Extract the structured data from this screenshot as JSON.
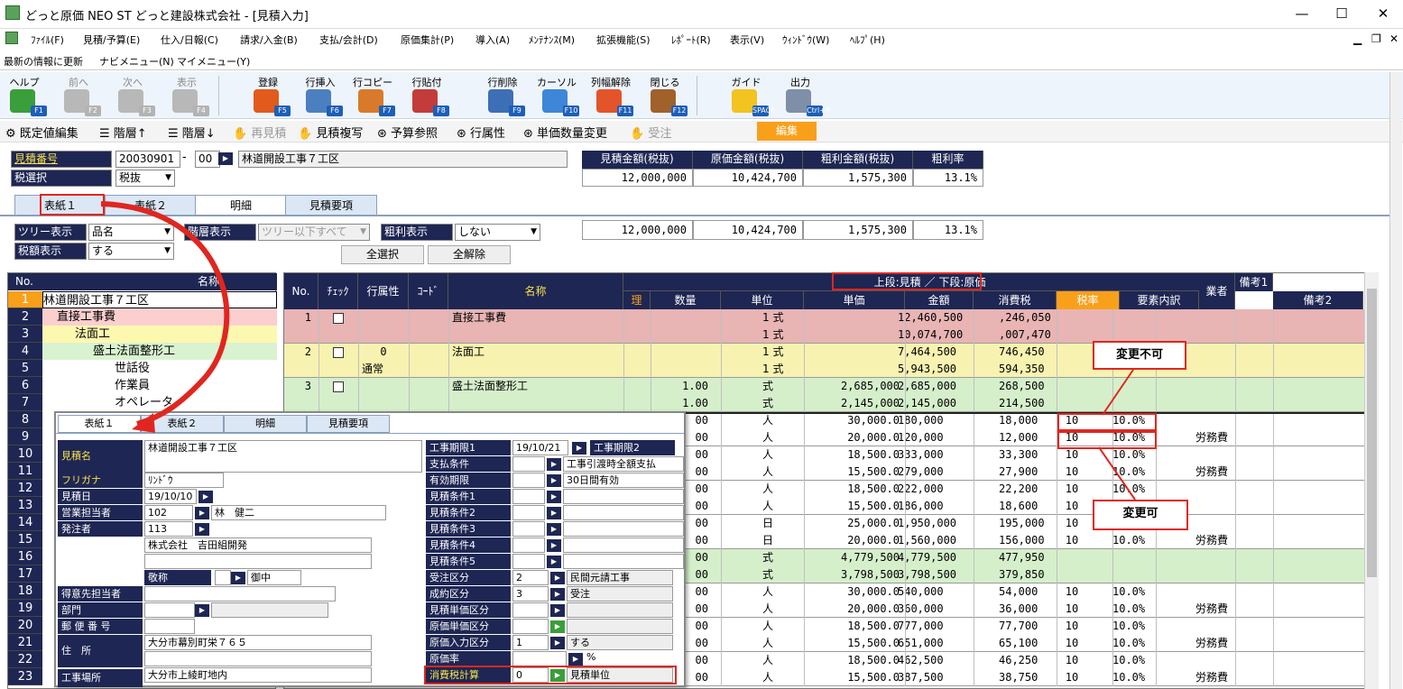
{
  "window": {
    "title": "どっと原価 NEO ST どっと建設株式会社 - [見積入力]",
    "min": "—",
    "max": "☐",
    "close": "✕"
  },
  "menu": [
    "ﾌｧｲﾙ(F)",
    "見積/予算(E)",
    "仕入/日報(C)",
    "請求/入金(B)",
    "支払/会計(D)",
    "原価集計(P)",
    "導入(A)",
    "ﾒﾝﾃﾅﾝｽ(M)",
    "拡張機能(S)",
    "ﾚﾎﾟｰﾄ(R)",
    "表示(V)",
    "ｳｨﾝﾄﾞｳ(W)",
    "ﾍﾙﾌﾟ(H)"
  ],
  "nav": [
    "最新の情報に更新",
    "ナビメニュー(N)",
    "マイメニュー(Y)"
  ],
  "toolbar": [
    {
      "label": "ヘルプ",
      "key": "F1",
      "icon": "help-icon",
      "color": "#3a9e3a",
      "disabled": false
    },
    {
      "label": "前へ",
      "key": "F2",
      "icon": "back-arrow-icon",
      "color": "#b8b8b8",
      "disabled": true
    },
    {
      "label": "次へ",
      "key": "F3",
      "icon": "forward-arrow-icon",
      "color": "#b8b8b8",
      "disabled": true
    },
    {
      "label": "表示",
      "key": "F4",
      "icon": "magnifier-icon",
      "color": "#b8b8b8",
      "disabled": true
    },
    {
      "label": "登録",
      "key": "F5",
      "icon": "ok-icon",
      "color": "#e25a1c",
      "disabled": false
    },
    {
      "label": "行挿入",
      "key": "F6",
      "icon": "row-insert-icon",
      "color": "#4c7fc0",
      "disabled": false
    },
    {
      "label": "行コピー",
      "key": "F7",
      "icon": "row-copy-icon",
      "color": "#d97a2b",
      "disabled": false
    },
    {
      "label": "行貼付",
      "key": "F8",
      "icon": "row-paste-icon",
      "color": "#c43b3b",
      "disabled": false
    },
    {
      "label": "行削除",
      "key": "F9",
      "icon": "row-delete-icon",
      "color": "#3d6fb6",
      "disabled": false
    },
    {
      "label": "カーソル",
      "key": "F10",
      "icon": "cursor-move-icon",
      "color": "#3d86d8",
      "disabled": false
    },
    {
      "label": "列幅解除",
      "key": "F11",
      "icon": "column-width-icon",
      "color": "#e3542b",
      "disabled": false
    },
    {
      "label": "閉じる",
      "key": "F12",
      "icon": "door-close-icon",
      "color": "#a0612b",
      "disabled": false
    },
    {
      "label": "ガイド",
      "key": "SPACE",
      "icon": "lightbulb-icon",
      "color": "#f2c321",
      "disabled": false
    },
    {
      "label": "出力",
      "key": "Ctrl+P",
      "icon": "printer-icon",
      "color": "#7f8fa8",
      "disabled": false
    }
  ],
  "subbar": [
    "既定値編集",
    "階層↑",
    "階層↓",
    "再見積",
    "見積複写",
    "予算参照",
    "行属性",
    "単価数量変更",
    "受注"
  ],
  "edit_label": "編集",
  "header": {
    "estimate_no_label": "見積番号",
    "estimate_no": "20030901",
    "dash": "-",
    "branch": "00",
    "project_name": "林道開設工事７工区",
    "tax_label": "税選択",
    "tax_value": "税抜"
  },
  "summary": {
    "headers": [
      "見積金額(税抜)",
      "原価金額(税抜)",
      "粗利金額(税抜)",
      "粗利率"
    ],
    "values": [
      "12,000,000",
      "10,424,700",
      "1,575,300",
      "13.1%"
    ],
    "values2": [
      "12,000,000",
      "10,424,700",
      "1,575,300",
      "13.1%"
    ]
  },
  "tabs": [
    "表紙１",
    "表紙２",
    "明細",
    "見積要項"
  ],
  "filters": {
    "tree_label": "ツリー表示",
    "tree_value": "品名",
    "tax_disp_label": "税額表示",
    "tax_disp_value": "する",
    "level_label": "階層表示",
    "level_value": "ツリー以下すべて",
    "gross_label": "粗利表示",
    "gross_value": "しない",
    "select_all": "全選択",
    "deselect_all": "全解除"
  },
  "tree": {
    "header_no": "No.",
    "header_name": "名称",
    "rows": [
      {
        "no": "1",
        "name": "林道開設工事７工区"
      },
      {
        "no": "2",
        "name": "直接工事費"
      },
      {
        "no": "3",
        "name": "法面工"
      },
      {
        "no": "4",
        "name": "盛土法面整形工"
      },
      {
        "no": "5",
        "name": "世話役"
      },
      {
        "no": "6",
        "name": "作業員"
      },
      {
        "no": "7",
        "name": "オペレータ"
      },
      {
        "no": "8",
        "name": ""
      },
      {
        "no": "9",
        "name": ""
      },
      {
        "no": "10",
        "name": ""
      },
      {
        "no": "11",
        "name": ""
      },
      {
        "no": "12",
        "name": ""
      },
      {
        "no": "13",
        "name": ""
      },
      {
        "no": "14",
        "name": ""
      },
      {
        "no": "15",
        "name": ""
      },
      {
        "no": "16",
        "name": ""
      },
      {
        "no": "17",
        "name": ""
      },
      {
        "no": "18",
        "name": ""
      },
      {
        "no": "19",
        "name": ""
      },
      {
        "no": "20",
        "name": ""
      },
      {
        "no": "21",
        "name": ""
      },
      {
        "no": "22",
        "name": ""
      },
      {
        "no": "23",
        "name": ""
      }
    ]
  },
  "grid": {
    "top_header": "上段:見積 ／ 下段:原価",
    "headers": [
      "No.",
      "ﾁｪｯｸ",
      "行属性",
      "ｺｰﾄﾞ",
      "名称",
      "理",
      "数量",
      "単位",
      "単価",
      "金額",
      "消費税",
      "税率",
      "要素内訳",
      "業者",
      "備考1",
      "備考2"
    ],
    "rows": [
      {
        "no": "1",
        "attr": "",
        "attr2": "",
        "name": "直接工事費",
        "qty": "",
        "qty2": "",
        "unit": "1 式",
        "unit2": "1 式",
        "price": "",
        "price2": "",
        "amount": "12,460,500",
        "amount2": "10,074,700",
        "tax": ",246,050",
        "tax2": ",007,470",
        "rate": "",
        "rate2": "",
        "pct": "",
        "pct2": "",
        "elem": "",
        "elem2": ""
      },
      {
        "no": "2",
        "attr": "0",
        "attr2": "通常",
        "name": "法面工",
        "qty": "",
        "qty2": "",
        "unit": "1 式",
        "unit2": "1 式",
        "price": "",
        "price2": "",
        "amount": "7,464,500",
        "amount2": "5,943,500",
        "tax": "746,450",
        "tax2": "594,350",
        "rate": "",
        "rate2": "",
        "pct": "",
        "pct2": "",
        "elem": "",
        "elem2": ""
      },
      {
        "no": "3",
        "attr": "",
        "attr2": "",
        "name": "盛土法面整形工",
        "qty": "1.00",
        "qty2": "1.00",
        "unit": "式",
        "unit2": "式",
        "price": "2,685,000",
        "price2": "2,145,000",
        "amount": "2,685,000",
        "amount2": "2,145,000",
        "tax": "268,500",
        "tax2": "214,500",
        "rate": "",
        "rate2": "",
        "pct": "",
        "pct2": "",
        "elem": "",
        "elem2": ""
      },
      {
        "no": "",
        "attr": "",
        "attr2": "",
        "name": "",
        "qty": "00",
        "qty2": "00",
        "unit": "人",
        "unit2": "人",
        "price": "30,000.0",
        "price2": "20,000.0",
        "amount": "180,000",
        "amount2": "120,000",
        "tax": "18,000",
        "tax2": "12,000",
        "rate": "10",
        "rate2": "10",
        "pct": "10.0%",
        "pct2": "10.0%",
        "elem": "",
        "elem2": "労務費"
      },
      {
        "no": "",
        "attr": "",
        "attr2": "",
        "name": "",
        "qty": "00",
        "qty2": "00",
        "unit": "人",
        "unit2": "人",
        "price": "18,500.0",
        "price2": "15,500.0",
        "amount": "333,000",
        "amount2": "279,000",
        "tax": "33,300",
        "tax2": "27,900",
        "rate": "10",
        "rate2": "10",
        "pct": "10.0%",
        "pct2": "10.0%",
        "elem": "",
        "elem2": "労務費"
      },
      {
        "no": "",
        "attr": "",
        "attr2": "",
        "name": "",
        "qty": "00",
        "qty2": "00",
        "unit": "人",
        "unit2": "人",
        "price": "18,500.0",
        "price2": "15,500.0",
        "amount": "222,000",
        "amount2": "186,000",
        "tax": "22,200",
        "tax2": "18,600",
        "rate": "10",
        "rate2": "10",
        "pct": "10.0%",
        "pct2": "10.0%",
        "elem": "",
        "elem2": ""
      },
      {
        "no": "",
        "attr": "",
        "attr2": "",
        "name": "",
        "qty": "00",
        "qty2": "00",
        "unit": "日",
        "unit2": "日",
        "price": "25,000.0",
        "price2": "20,000.0",
        "amount": "1,950,000",
        "amount2": "1,560,000",
        "tax": "195,000",
        "tax2": "156,000",
        "rate": "10",
        "rate2": "10",
        "pct": "10.0%",
        "pct2": "10.0%",
        "elem": "",
        "elem2": "労務費"
      },
      {
        "no": "",
        "attr": "",
        "attr2": "",
        "name": "",
        "qty": "00",
        "qty2": "00",
        "unit": "式",
        "unit2": "式",
        "price": "4,779,500",
        "price2": "3,798,500",
        "amount": "4,779,500",
        "amount2": "3,798,500",
        "tax": "477,950",
        "tax2": "379,850",
        "rate": "",
        "rate2": "",
        "pct": "",
        "pct2": "",
        "elem": "",
        "elem2": ""
      },
      {
        "no": "",
        "attr": "",
        "attr2": "",
        "name": "",
        "qty": "00",
        "qty2": "00",
        "unit": "人",
        "unit2": "人",
        "price": "30,000.0",
        "price2": "20,000.0",
        "amount": "540,000",
        "amount2": "360,000",
        "tax": "54,000",
        "tax2": "36,000",
        "rate": "10",
        "rate2": "10",
        "pct": "10.0%",
        "pct2": "10.0%",
        "elem": "",
        "elem2": "労務費"
      },
      {
        "no": "",
        "attr": "",
        "attr2": "",
        "name": "",
        "qty": "00",
        "qty2": "00",
        "unit": "人",
        "unit2": "人",
        "price": "18,500.0",
        "price2": "15,500.0",
        "amount": "777,000",
        "amount2": "651,000",
        "tax": "77,700",
        "tax2": "65,100",
        "rate": "10",
        "rate2": "10",
        "pct": "10.0%",
        "pct2": "10.0%",
        "elem": "",
        "elem2": "労務費"
      },
      {
        "no": "",
        "attr": "",
        "attr2": "",
        "name": "",
        "qty": "00",
        "qty2": "00",
        "unit": "人",
        "unit2": "人",
        "price": "18,500.0",
        "price2": "15,500.0",
        "amount": "462,500",
        "amount2": "387,500",
        "tax": "46,250",
        "tax2": "38,750",
        "rate": "10",
        "rate2": "10",
        "pct": "10.0%",
        "pct2": "10.0%",
        "elem": "",
        "elem2": "労務費"
      }
    ]
  },
  "callouts": {
    "not_changeable": "変更不可",
    "changeable": "変更可"
  },
  "overlay": {
    "tabs": [
      "表紙１",
      "表紙２",
      "明細",
      "見積要項"
    ],
    "left": {
      "name_label": "見積名",
      "name": "林道開設工事７工区",
      "kana_label": "フリガナ",
      "kana": "ﾘﾝﾄﾞｳ",
      "date_label": "見積日",
      "date": "19/10/10",
      "sales_label": "営業担当者",
      "sales_code": "102",
      "sales_name": "林　健二",
      "client_label": "発注者",
      "client_code": "113",
      "client_name": "株式会社　吉田組開発",
      "honorific_label": "敬称",
      "honorific": "御中",
      "contact_label": "得意先担当者",
      "dept_label": "部門",
      "zip_label": "郵 便 番 号",
      "addr_label": "住　所",
      "addr": "大分市幕別町栄７６５",
      "site_label": "工事場所",
      "site": "大分市上綾町地内"
    },
    "right": {
      "period1_label": "工事期限1",
      "period1": "19/10/21",
      "period2_label": "工事期限2",
      "pay_label": "支払条件",
      "pay": "工事引渡時全額支払",
      "valid_label": "有効期限",
      "valid": "30日間有効",
      "cond1": "見積条件1",
      "cond2": "見積条件2",
      "cond3": "見積条件3",
      "cond4": "見積条件4",
      "cond5": "見積条件5",
      "order_type_label": "受注区分",
      "order_type_code": "2",
      "order_type": "民間元請工事",
      "result_label": "成約区分",
      "result_code": "3",
      "result": "受注",
      "est_unit_label": "見積単価区分",
      "cost_unit_label": "原価単価区分",
      "cost_input_label": "原価入力区分",
      "cost_input_code": "1",
      "cost_input": "する",
      "cost_rate_label": "原価率",
      "cost_rate_unit": "%",
      "tax_calc_label": "消費税計算",
      "tax_calc_code": "0",
      "tax_calc": "見積単位"
    }
  }
}
